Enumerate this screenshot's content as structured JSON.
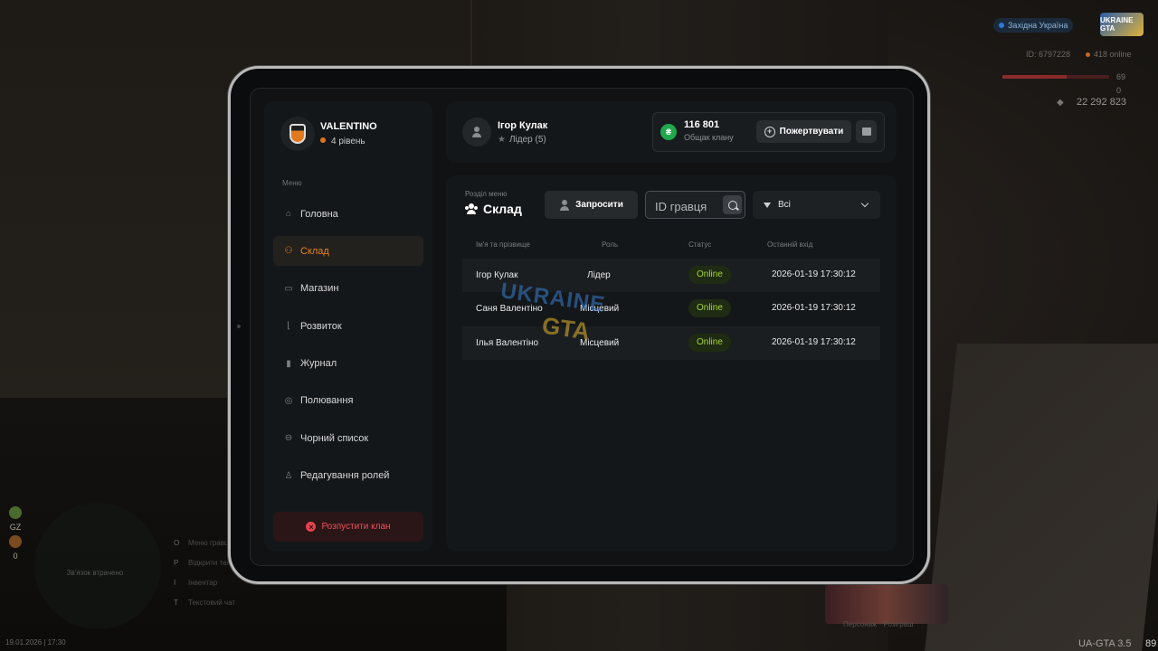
{
  "hud": {
    "server": "Західна Україна",
    "logo_text": "UKRAINE GTA",
    "player_id": "ID: 6797228",
    "online": "418 online",
    "hp": "69",
    "armor": "0",
    "money": "22 292 823",
    "gz_label": "GZ",
    "gz_value": "0",
    "radar_text": "Зв'язок втрачено",
    "menu_hints": [
      {
        "key": "O",
        "label": "Меню гравця"
      },
      {
        "key": "P",
        "label": "Відкрити телефон"
      },
      {
        "key": "I",
        "label": "Інвентар"
      },
      {
        "key": "T",
        "label": "Текстовий чат"
      }
    ],
    "datetime": "19.01.2026 | 17:30",
    "brand": "UA-GTA 3.5",
    "fps": "89",
    "promo_label": "Персонаж · Розіграш"
  },
  "profile": {
    "name": "VALENTINO",
    "level": "4 рівень"
  },
  "menu": {
    "title": "Меню",
    "items": [
      {
        "label": "Головна",
        "icon": "home-icon"
      },
      {
        "label": "Склад",
        "icon": "people-icon",
        "active": true
      },
      {
        "label": "Магазин",
        "icon": "basket-icon"
      },
      {
        "label": "Розвиток",
        "icon": "chart-icon"
      },
      {
        "label": "Журнал",
        "icon": "book-icon"
      },
      {
        "label": "Полювання",
        "icon": "target-icon"
      },
      {
        "label": "Чорний список",
        "icon": "block-icon"
      },
      {
        "label": "Редагування ролей",
        "icon": "user-edit-icon"
      }
    ],
    "dissolve_label": "Розпустити клан"
  },
  "header": {
    "user_name": "Ігор Кулак",
    "user_role": "Лідер (5)",
    "money_amount": "116 801",
    "money_label": "Общак клану",
    "donate_label": "Пожертвувати"
  },
  "section": {
    "label": "Розділ меню",
    "title": "Склад",
    "invite_label": "Запросити",
    "search_placeholder": "ID гравця",
    "filter_value": "Всі",
    "columns": [
      "Ім'я та прізвище",
      "Роль",
      "Статус",
      "Останній вхід"
    ],
    "rows": [
      {
        "name": "Ігор Кулак",
        "role": "Лідер",
        "status": "Online",
        "last": "2026-01-19 17:30:12"
      },
      {
        "name": "Саня Валентіно",
        "role": "Місцевий",
        "status": "Online",
        "last": "2026-01-19 17:30:12"
      },
      {
        "name": "Ілья Валентіно",
        "role": "Місцевий",
        "status": "Online",
        "last": "2026-01-19 17:30:12"
      }
    ]
  },
  "watermark": {
    "line1": "UKRAINE",
    "line2": "GTA"
  },
  "colors": {
    "accent": "#e8841e",
    "online": "#a6d63c",
    "danger": "#e5424c",
    "coin": "#1fa84d"
  }
}
